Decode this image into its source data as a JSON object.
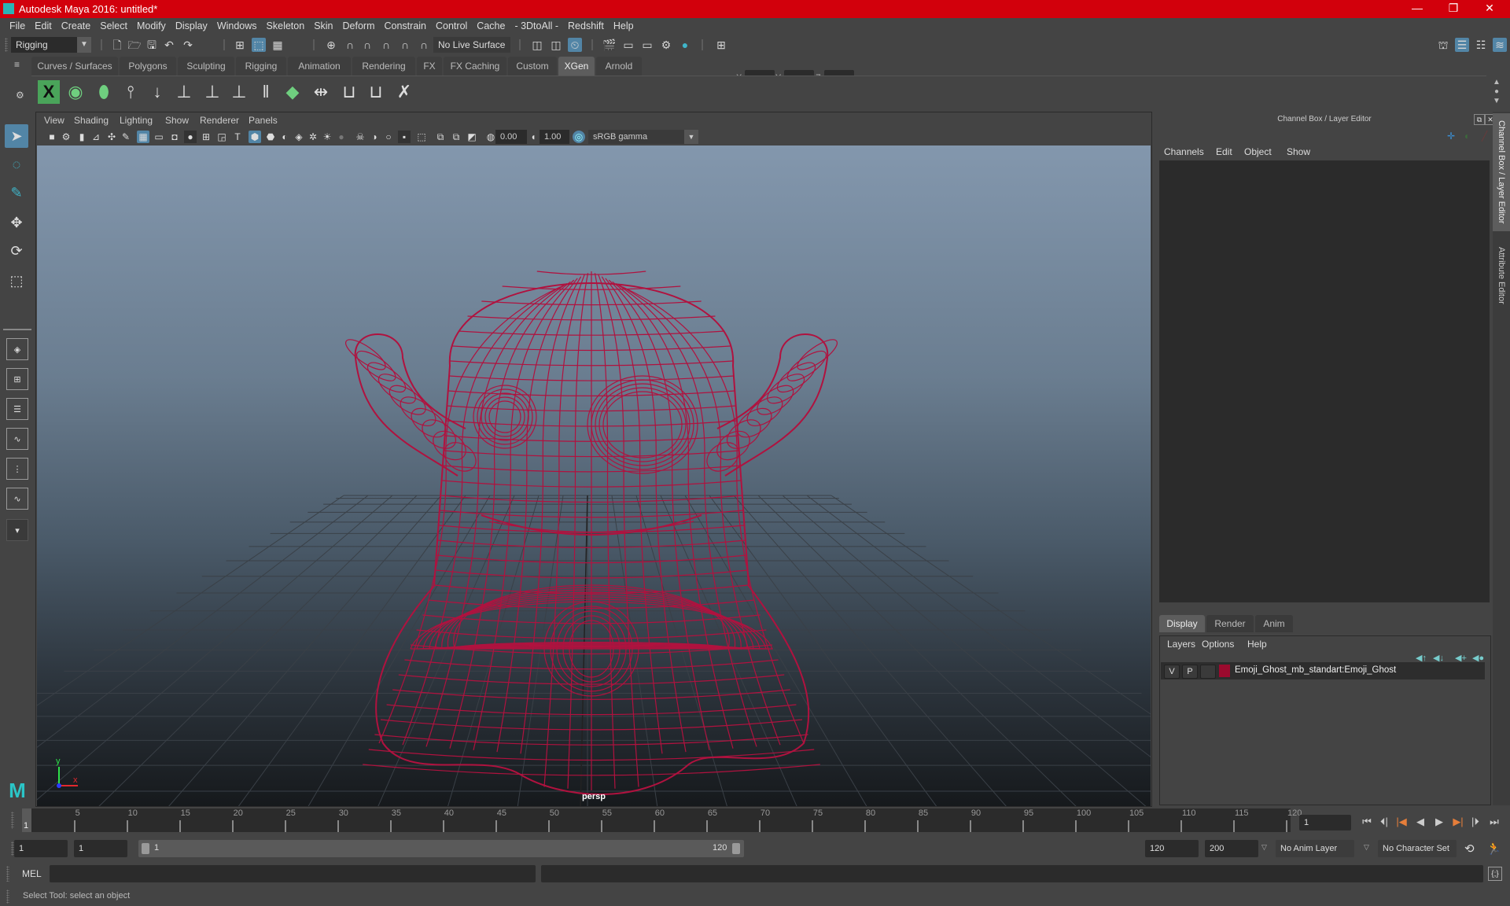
{
  "window": {
    "title": "Autodesk Maya 2016: untitled*",
    "controls": {
      "minimize": "—",
      "restore": "❐",
      "close": "✕"
    }
  },
  "menubar": [
    "File",
    "Edit",
    "Create",
    "Select",
    "Modify",
    "Display",
    "Windows",
    "Skeleton",
    "Skin",
    "Deform",
    "Constrain",
    "Control",
    "Cache",
    "- 3DtoAll -",
    "Redshift",
    "Help"
  ],
  "statusline": {
    "menuset": "Rigging",
    "live_surface": "No Live Surface",
    "xyz_labels": [
      "X:",
      "Y:",
      "Z:"
    ],
    "xyz_values": [
      "",
      "",
      ""
    ]
  },
  "shelf": {
    "tabs": [
      "Curves / Surfaces",
      "Polygons",
      "Sculpting",
      "Rigging",
      "Animation",
      "Rendering",
      "FX",
      "FX Caching",
      "Custom",
      "XGen",
      "Arnold"
    ],
    "active_tab": "XGen",
    "icons": [
      "xgen-editor-icon",
      "xgen-preview-icon",
      "xgen-clear-preview-icon",
      "add-guides-icon",
      "place-guides-icon",
      "add-guide-icon",
      "select-guide-icon",
      "lock-guide-icon",
      "guide-length-icon",
      "sculpt-guides-icon",
      "interactive-groom-icon",
      "select-groom-icon",
      "groom-region-icon",
      "delete-guides-icon"
    ]
  },
  "toolbox": {
    "tools": [
      "select-tool",
      "lasso-tool",
      "paint-select-tool",
      "move-tool",
      "rotate-tool",
      "scale-tool"
    ],
    "active_tool": "select-tool"
  },
  "viewport": {
    "menu": [
      "View",
      "Shading",
      "Lighting",
      "Show",
      "Renderer",
      "Panels"
    ],
    "exposure": "0.00",
    "gamma": "1.00",
    "color_space": "sRGB gamma",
    "camera": "persp",
    "wireframe_color": "#b0123f",
    "axis": {
      "x": "x",
      "y": "y"
    }
  },
  "channel_box": {
    "title": "Channel Box / Layer Editor",
    "menu": [
      "Channels",
      "Edit",
      "Object",
      "Show"
    ]
  },
  "layer_editor": {
    "tabs": [
      "Display",
      "Render",
      "Anim"
    ],
    "active_tab": "Display",
    "menu": [
      "Layers",
      "Options",
      "Help"
    ],
    "layers": [
      {
        "visible": "V",
        "playback": "P",
        "name": "Emoji_Ghost_mb_standart:Emoji_Ghost",
        "color": "#9b0a2e"
      }
    ]
  },
  "side_tabs": [
    "Channel Box / Layer Editor",
    "Attribute Editor"
  ],
  "time_slider": {
    "start": 1,
    "end": 120,
    "labels": [
      "5",
      "10",
      "15",
      "20",
      "25",
      "30",
      "35",
      "40",
      "45",
      "50",
      "55",
      "60",
      "65",
      "70",
      "75",
      "80",
      "85",
      "90",
      "95",
      "100",
      "105",
      "110",
      "115",
      "120"
    ],
    "current_frame_marker": "1",
    "current_frame": "1"
  },
  "playback": [
    "go-to-start",
    "step-back-frame",
    "step-back-key",
    "play-backwards",
    "play-forwards",
    "step-forward-key",
    "step-forward-frame",
    "go-to-end"
  ],
  "range_slider": {
    "anim_start": "1",
    "playback_start": "1",
    "range_start_label": "1",
    "range_end_label": "120",
    "playback_end": "120",
    "anim_end": "200",
    "anim_layer": "No Anim Layer",
    "character_set": "No Character Set"
  },
  "command_line": {
    "label": "MEL",
    "value": ""
  },
  "help_line": "Select Tool: select an object"
}
